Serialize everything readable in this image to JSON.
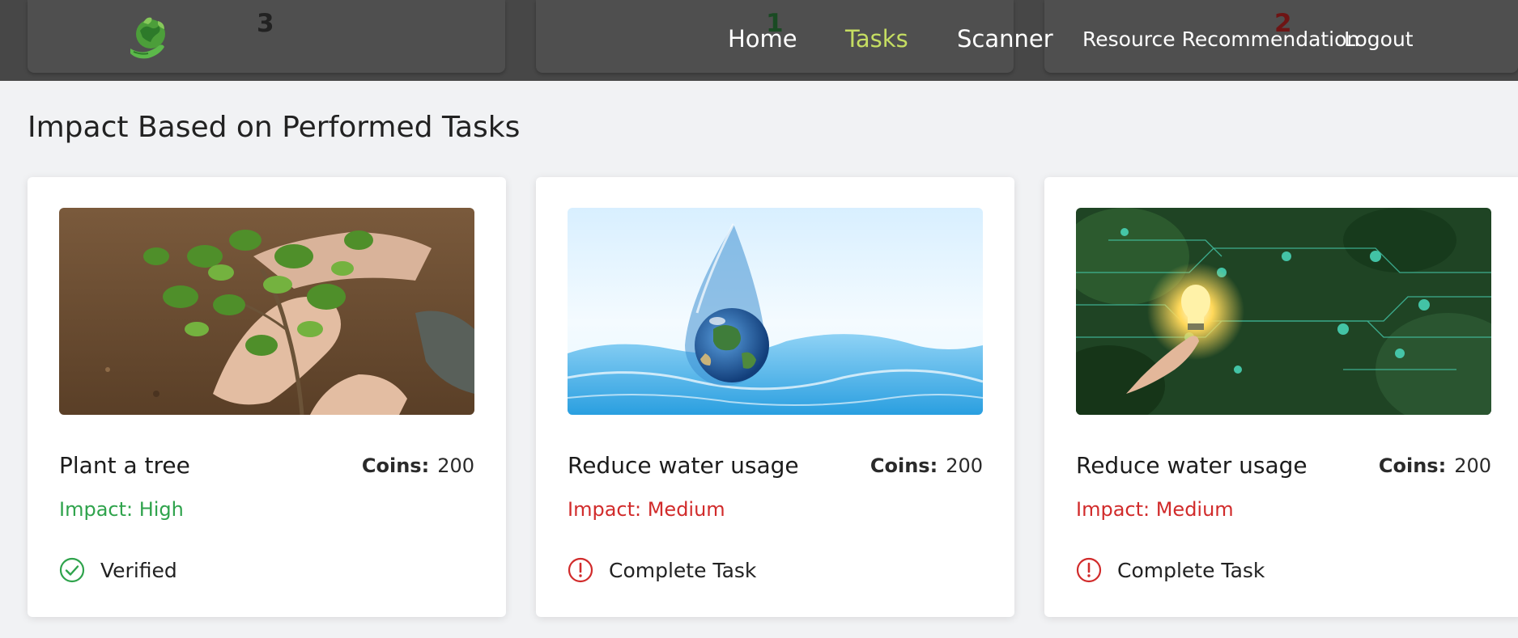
{
  "header": {
    "ranks": [
      "3",
      "1",
      "2"
    ],
    "rank_colors": [
      "#111111",
      "#1a4a23",
      "#6e1414"
    ],
    "nav": {
      "home": "Home",
      "tasks": "Tasks",
      "scanner": "Scanner",
      "resource": "Resource Recommendation",
      "logout": "Logout"
    },
    "active_tab": "Tasks",
    "active_color": "#c5dd62"
  },
  "page": {
    "title": "Impact Based on Performed Tasks"
  },
  "cards": [
    {
      "title": "Plant a tree",
      "coins_label": "Coins:",
      "coins": "200",
      "impact": "Impact: High",
      "status": "Verified",
      "status_icon": "check-circle-icon",
      "image": "tree-planting-photo",
      "impact_color": "#2fa34c"
    },
    {
      "title": "Reduce water usage",
      "coins_label": "Coins:",
      "coins": "200",
      "impact": "Impact: Medium",
      "status": "Complete Task",
      "status_icon": "alert-circle-icon",
      "image": "water-drop-earth-photo",
      "impact_color": "#d12b2b"
    },
    {
      "title": "Reduce water usage",
      "coins_label": "Coins:",
      "coins": "200",
      "impact": "Impact: Medium",
      "status": "Complete Task",
      "status_icon": "alert-circle-icon",
      "image": "green-energy-lightbulb-photo",
      "impact_color": "#d12b2b"
    }
  ]
}
